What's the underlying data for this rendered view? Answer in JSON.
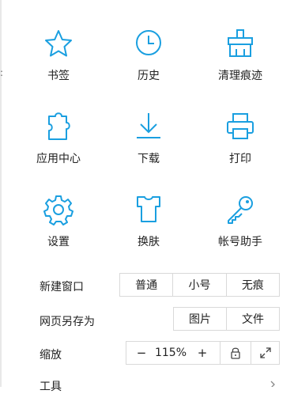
{
  "menu": {
    "items": [
      {
        "label": "书签",
        "icon": "star-icon"
      },
      {
        "label": "历史",
        "icon": "clock-icon"
      },
      {
        "label": "清理痕迹",
        "icon": "broom-icon"
      },
      {
        "label": "应用中心",
        "icon": "puzzle-icon"
      },
      {
        "label": "下载",
        "icon": "download-icon"
      },
      {
        "label": "打印",
        "icon": "printer-icon"
      },
      {
        "label": "设置",
        "icon": "gear-icon"
      },
      {
        "label": "换肤",
        "icon": "tshirt-icon"
      },
      {
        "label": "帐号助手",
        "icon": "key-icon"
      }
    ]
  },
  "new_window": {
    "label": "新建窗口",
    "options": [
      "普通",
      "小号",
      "无痕"
    ]
  },
  "save_page": {
    "label": "网页另存为",
    "options": [
      "图片",
      "文件"
    ]
  },
  "zoom": {
    "label": "缩放",
    "minus": "−",
    "value": "115%",
    "plus": "+",
    "lock_icon": "lock-icon",
    "fullscreen_icon": "fullscreen-icon"
  },
  "tools": {
    "label": "工具"
  },
  "colors": {
    "accent": "#1a9fe0"
  }
}
